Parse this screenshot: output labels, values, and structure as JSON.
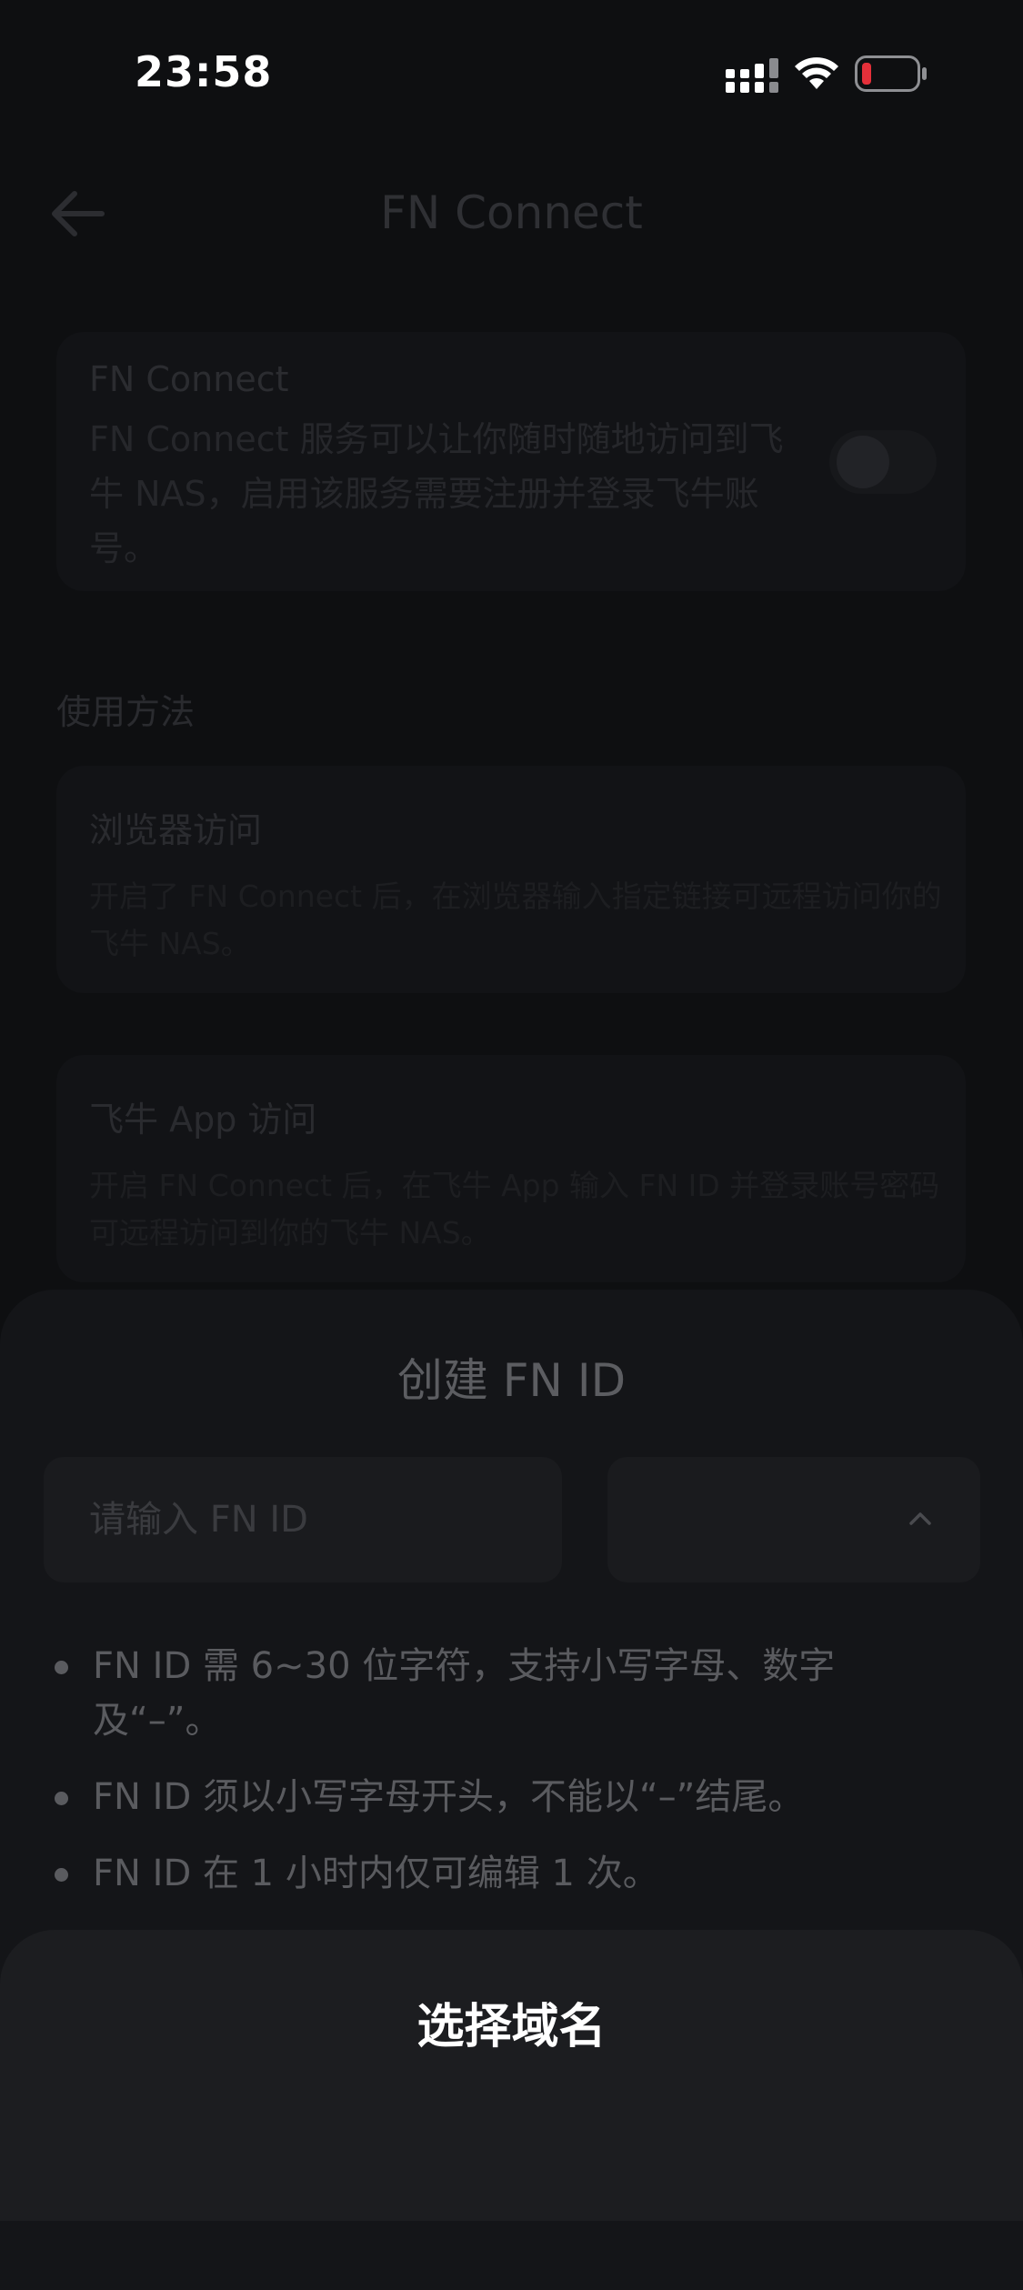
{
  "status_bar": {
    "time": "23:58",
    "signal_icon": "cellular-signal-icon",
    "wifi_icon": "wifi-icon",
    "battery_icon": "battery-low-icon",
    "battery_color": "#e5303a"
  },
  "header": {
    "title": "FN Connect",
    "back_icon": "back-arrow-icon"
  },
  "service": {
    "title": "FN Connect",
    "description": "FN Connect 服务可以让你随时随地访问到飞牛 NAS，启用该服务需要注册并登录飞牛账号。",
    "enabled": false
  },
  "usage": {
    "heading": "使用方法",
    "items": [
      {
        "title": "浏览器访问",
        "description": "开启了 FN Connect 后，在浏览器输入指定链接可远程访问你的飞牛 NAS。"
      },
      {
        "title": "飞牛 App 访问",
        "description": "开启 FN Connect 后，在飞牛 App 输入 FN ID 并登录账号密码可远程访问到你的飞牛 NAS。"
      }
    ]
  },
  "create_sheet": {
    "title": "创建 FN ID",
    "input_placeholder": "请输入 FN ID",
    "input_value": "",
    "domain_value": "",
    "chevron_icon": "chevron-up-icon",
    "rules": [
      "FN ID 需 6~30 位字符，支持小写字母、数字及“–”。",
      "FN ID 须以小写字母开头，不能以“–”结尾。",
      "FN ID 在 1 小时内仅可编辑 1 次。"
    ]
  },
  "domain_sheet": {
    "title": "选择域名"
  }
}
